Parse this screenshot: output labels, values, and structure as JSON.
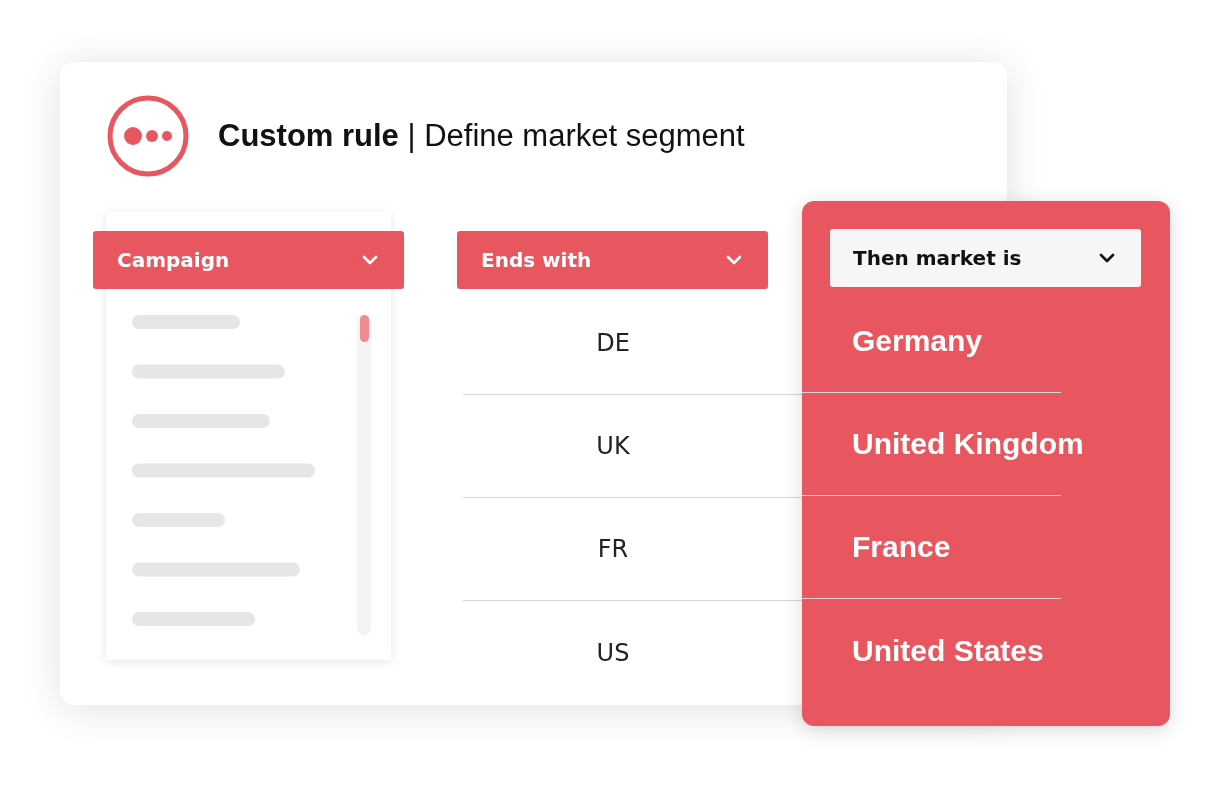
{
  "header": {
    "title": "Custom rule",
    "separator": "|",
    "subtitle": "Define market segment"
  },
  "campaign": {
    "dropdown": {
      "label": "Campaign"
    }
  },
  "condition": {
    "dropdown": {
      "label": "Ends with"
    },
    "values": [
      "DE",
      "UK",
      "FR",
      "US"
    ]
  },
  "result": {
    "dropdown": {
      "label": "Then market is"
    },
    "markets": [
      "Germany",
      "United Kingdom",
      "France",
      "United States"
    ]
  }
}
